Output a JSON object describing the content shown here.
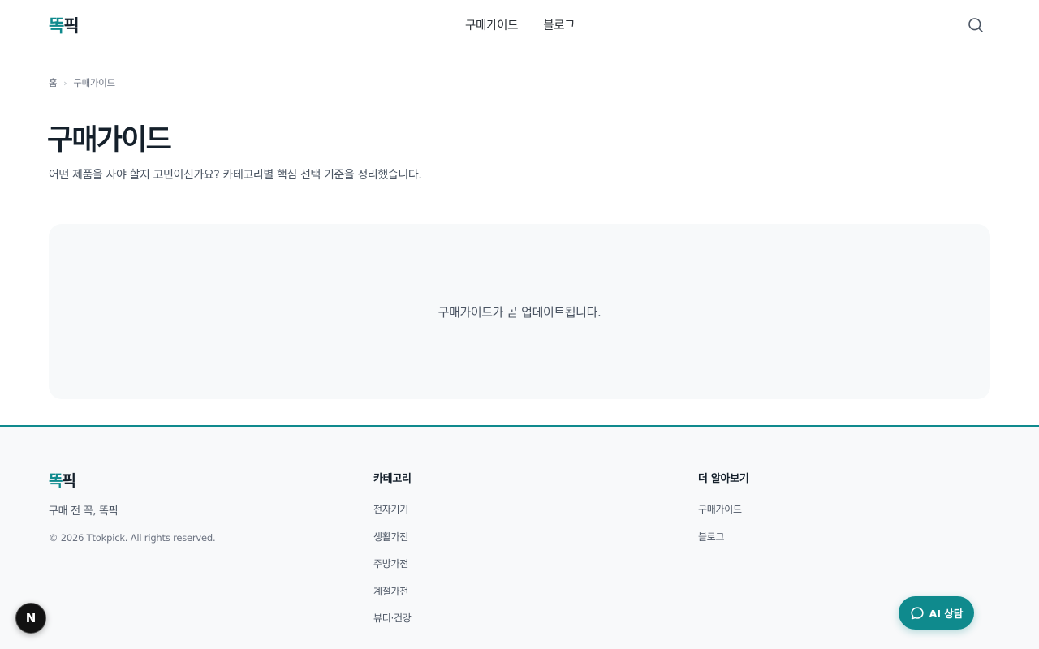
{
  "header": {
    "logo_part1": "똑",
    "logo_part2": "픽",
    "nav": [
      {
        "label": "구매가이드"
      },
      {
        "label": "블로그"
      }
    ],
    "search_icon": "search-icon"
  },
  "breadcrumb": {
    "home": "홈",
    "separator": "›",
    "current": "구매가이드"
  },
  "page": {
    "title": "구매가이드",
    "description": "어떤 제품을 사야 할지 고민이신가요? 카테고리별 핵심 선택 기준을 정리했습니다.",
    "empty_message": "구매가이드가 곧 업데이트됩니다."
  },
  "footer": {
    "logo_part1": "똑",
    "logo_part2": "픽",
    "tagline": "구매 전 꼭, 똑픽",
    "copyright": "© 2026 Ttokpick. All rights reserved.",
    "categories": {
      "heading": "카테고리",
      "items": [
        "전자기기",
        "생활가전",
        "주방가전",
        "계절가전",
        "뷰티·건강"
      ]
    },
    "more": {
      "heading": "더 알아보기",
      "items": [
        "구매가이드",
        "블로그"
      ]
    }
  },
  "floating": {
    "ai_button_label": "AI 상담",
    "n_badge": "N"
  },
  "colors": {
    "brand": "#0f8a8d",
    "text_dark": "#15202b",
    "panel_bg": "#f7f9fa",
    "footer_bg": "#f8f9fa"
  }
}
